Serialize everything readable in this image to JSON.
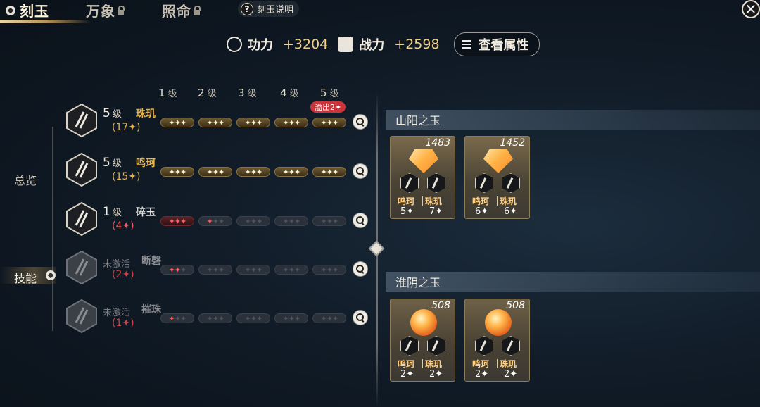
{
  "tabs": [
    {
      "label": "刻玉",
      "active": true
    },
    {
      "label": "万象",
      "locked": true
    },
    {
      "label": "照命",
      "locked": true
    }
  ],
  "help_label": "刻玉说明",
  "close_symbol": "✕",
  "stats": {
    "gongli_label": "功力",
    "gongli_value": "+3204",
    "zhanli_label": "战力",
    "zhanli_value": "+2598",
    "attr_button": "查看属性"
  },
  "nav": {
    "overview": "总览",
    "skills": "技能",
    "active": "技能"
  },
  "levels": [
    "1",
    "2",
    "3",
    "4",
    "5"
  ],
  "level_unit": "级",
  "overflow_badge": "溢出2✦",
  "skills": [
    {
      "level": "5",
      "unit": "级",
      "name": "珠玑",
      "count": "(17✦)",
      "state": "active",
      "color": "#e6b44c",
      "pips": [
        "gold",
        "gold",
        "gold",
        "gold",
        "gold"
      ]
    },
    {
      "level": "5",
      "unit": "级",
      "name": "鸣珂",
      "count": "(15✦)",
      "state": "active",
      "color": "#e6b44c",
      "pips": [
        "gold",
        "gold",
        "gold",
        "gold",
        "gold"
      ]
    },
    {
      "level": "1",
      "unit": "级",
      "name": "碎玉",
      "count": "(4✦)",
      "state": "active",
      "color": "#e0e0e0",
      "pips": [
        "red",
        "mix1",
        "empty",
        "empty",
        "empty"
      ]
    },
    {
      "level": "未激活",
      "unit": "",
      "name": "断磬",
      "count": "(2✦)",
      "state": "inactive",
      "color": "#8b8d92",
      "pips": [
        "mix2",
        "empty",
        "empty",
        "empty",
        "empty"
      ]
    },
    {
      "level": "未激活",
      "unit": "",
      "name": "摧珠",
      "count": "(1✦)",
      "state": "inactive",
      "color": "#8b8d92",
      "pips": [
        "mix1",
        "empty",
        "empty",
        "empty",
        "empty"
      ]
    }
  ],
  "sections": [
    {
      "title": "山阳之玉",
      "cards": [
        {
          "score": "1483",
          "type": "diamond",
          "a_name": "鸣珂",
          "b_name": "珠玑",
          "a_val": "5✦",
          "b_val": "7✦"
        },
        {
          "score": "1452",
          "type": "diamond",
          "a_name": "鸣珂",
          "b_name": "珠玑",
          "a_val": "6✦",
          "b_val": "6✦"
        }
      ]
    },
    {
      "title": "淮阴之玉",
      "cards": [
        {
          "score": "508",
          "type": "orb",
          "a_name": "鸣珂",
          "b_name": "珠玑",
          "a_val": "2✦",
          "b_val": "2✦"
        },
        {
          "score": "508",
          "type": "orb",
          "a_name": "鸣珂",
          "b_name": "珠玑",
          "a_val": "2✦",
          "b_val": "2✦"
        }
      ]
    }
  ]
}
